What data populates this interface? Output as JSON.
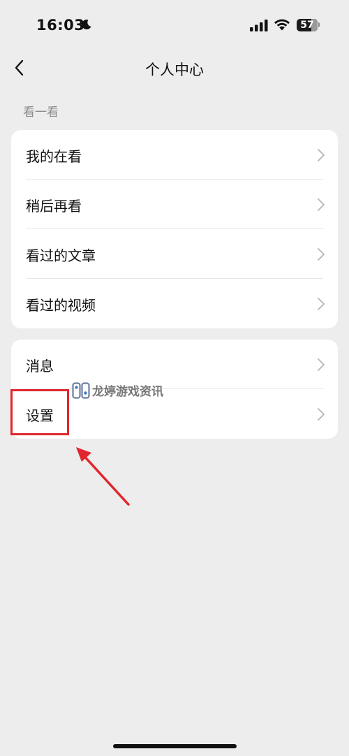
{
  "status_bar": {
    "time": "16:03",
    "battery_level": "57",
    "icons": [
      "moon-icon",
      "signal-icon",
      "wifi-icon",
      "battery-icon"
    ]
  },
  "nav": {
    "title": "个人中心",
    "back_icon": "chevron-left-icon"
  },
  "section": {
    "label": "看一看"
  },
  "group1": {
    "items": [
      {
        "label": "我的在看"
      },
      {
        "label": "稍后再看"
      },
      {
        "label": "看过的文章"
      },
      {
        "label": "看过的视频"
      }
    ]
  },
  "group2": {
    "items": [
      {
        "label": "消息"
      },
      {
        "label": "设置"
      }
    ]
  },
  "watermark": {
    "text": "龙婷游戏资讯"
  },
  "colors": {
    "background": "#ededed",
    "card": "#ffffff",
    "annotation": "#e0262e",
    "secondary_text": "#8a8a8a",
    "chevron": "#b5b5b5"
  }
}
